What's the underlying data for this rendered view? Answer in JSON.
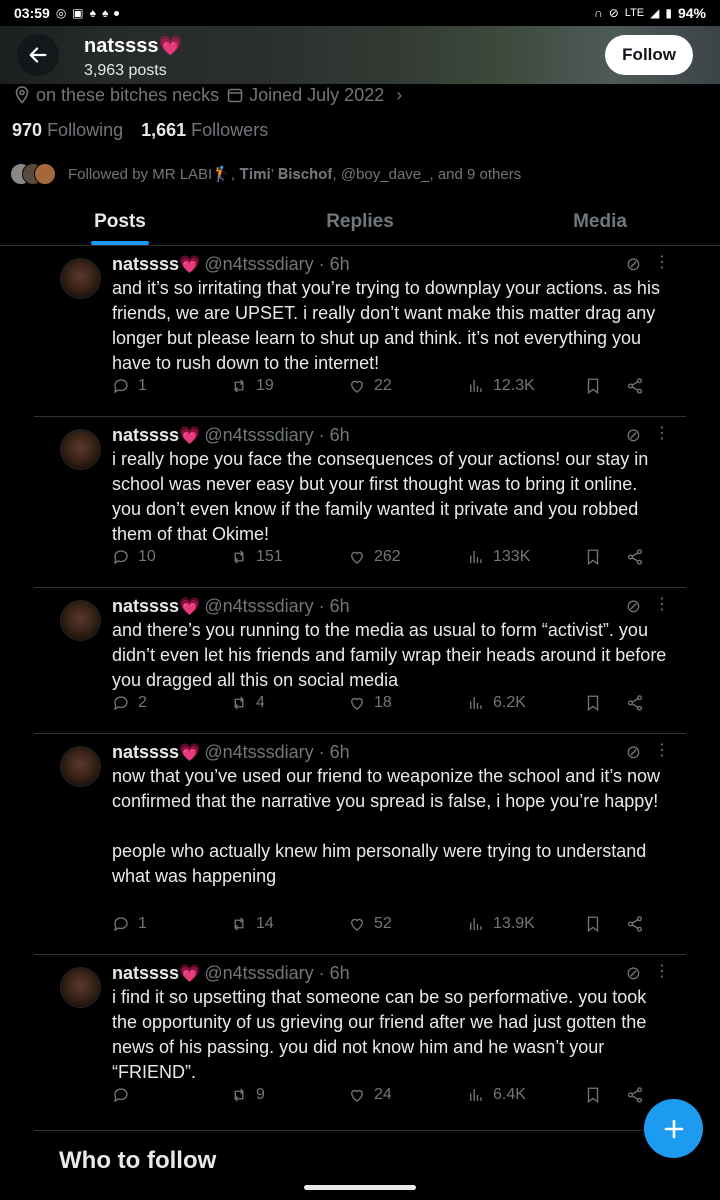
{
  "status_bar": {
    "time": "03:59",
    "network": "LTE",
    "battery": "94%"
  },
  "header": {
    "name": "natssss",
    "name_emoji": "💗",
    "posts_count": "3,963 posts",
    "follow_label": "Follow"
  },
  "profile": {
    "location": "on these bitches necks",
    "joined": "Joined July 2022",
    "following_count": "970",
    "following_label": "Following",
    "followers_count": "1,661",
    "followers_label": "Followers",
    "followed_by": "Followed by MR LABI🏌, 𝐓𝐢𝐦𝐢’ 𝐁𝐢𝐬𝐜𝐡𝐨𝐟, @boy_dave_, and 9 others"
  },
  "tabs": [
    {
      "label": "Posts"
    },
    {
      "label": "Replies"
    },
    {
      "label": "Media"
    }
  ],
  "tweets": [
    {
      "name": "natssss",
      "handle_time": "@n4tsssdiary · 6h",
      "text": "and it’s so irritating that you’re trying to downplay your actions. as his friends, we are UPSET. i really don’t want make this matter drag any longer but please learn to shut up and think. it’s not everything you have to rush down to the internet!",
      "replies": "1",
      "reposts": "19",
      "likes": "22",
      "views": "12.3K"
    },
    {
      "name": "natssss",
      "handle_time": "@n4tsssdiary · 6h",
      "text": "i really hope you face the consequences of your actions! our stay in school was never easy but your first thought was to bring it online. you don’t even know if the family wanted it private and you robbed them of that Okime!",
      "replies": "10",
      "reposts": "151",
      "likes": "262",
      "views": "133K"
    },
    {
      "name": "natssss",
      "handle_time": "@n4tsssdiary · 6h",
      "text": "and there’s you running to the media as usual to form “activist”. you didn’t even let his friends and family wrap their heads around it before you dragged all this on social media",
      "replies": "2",
      "reposts": "4",
      "likes": "18",
      "views": "6.2K"
    },
    {
      "name": "natssss",
      "handle_time": "@n4tsssdiary · 6h",
      "text": "now that you’ve used our friend to weaponize the school and it’s now confirmed that the narrative you spread is false, i hope you’re happy!\n\npeople who actually knew him personally were trying to understand what was happening",
      "replies": "1",
      "reposts": "14",
      "likes": "52",
      "views": "13.9K"
    },
    {
      "name": "natssss",
      "handle_time": "@n4tsssdiary · 6h",
      "text": "i find it so upsetting that someone can be so performative. you took the opportunity of us grieving our friend after we had just gotten the news of his passing. you did not know him and he wasn’t your “FRIEND”.",
      "replies": "",
      "reposts": "9",
      "likes": "24",
      "views": "6.4K"
    }
  ],
  "who_to_follow": "Who to follow",
  "colors": {
    "accent": "#1d9bf0",
    "muted": "#71767b",
    "text": "#e7e9ea",
    "background": "#000000",
    "heart": "#ff3f8a"
  },
  "icons": {
    "back": "arrow-left-icon",
    "compose": "plus-icon",
    "location": "location-pin-icon",
    "calendar": "calendar-icon"
  }
}
